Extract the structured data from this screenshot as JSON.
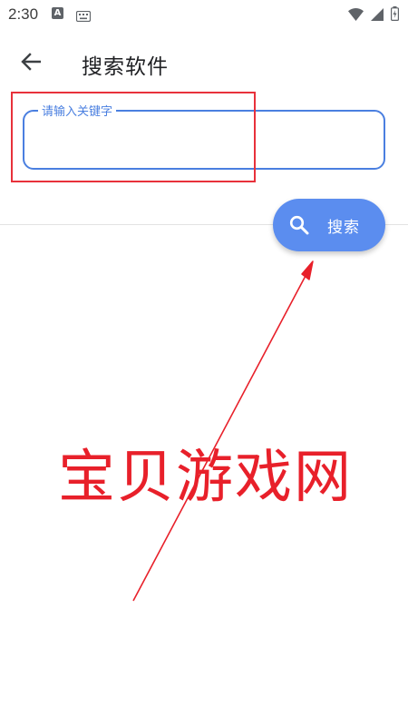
{
  "status_bar": {
    "time": "2:30",
    "a_badge": "A",
    "icons": [
      "keyboard-icon",
      "wifi-icon",
      "signal-icon",
      "battery-icon"
    ]
  },
  "app_bar": {
    "title": "搜索软件",
    "back_icon": "back-arrow-icon"
  },
  "search": {
    "label": "请输入关键字",
    "value": "",
    "button_label": "搜索",
    "button_icon": "search-icon"
  },
  "annotation": {
    "watermark_text": "宝贝游戏网",
    "color": "#e8202a"
  },
  "colors": {
    "accent": "#4a7fe0",
    "button": "#5b8def"
  }
}
